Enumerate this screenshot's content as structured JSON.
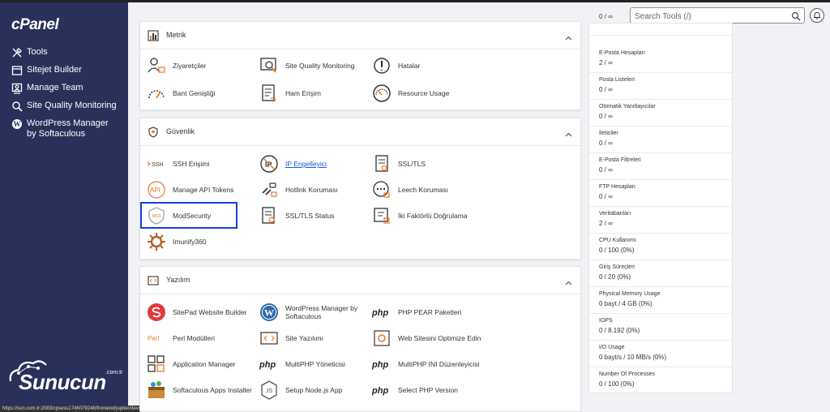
{
  "sidebar": {
    "logo": "cPanel",
    "items": [
      {
        "label": "Tools",
        "icon": "tools-icon"
      },
      {
        "label": "Sitejet Builder",
        "icon": "sitejet-icon"
      },
      {
        "label": "Manage Team",
        "icon": "team-icon"
      },
      {
        "label": "Site Quality Monitoring",
        "icon": "magnifier-icon"
      },
      {
        "label": "WordPress Manager by Softaculous",
        "icon": "wordpress-icon"
      }
    ],
    "brand": "Sunucun",
    "brand_suffix": ".com.tr"
  },
  "statusbar": "https://sun.com.tr:2083/cpsess1746079248/frontend/jupiter/devwin/index.html",
  "header": {
    "search_placeholder": "Search Tools (/)"
  },
  "sections": {
    "metrik": {
      "title": "Metrik",
      "items": [
        {
          "label": "Ziyaretçiler",
          "icon": "visitors-icon"
        },
        {
          "label": "Site Quality Monitoring",
          "icon": "site-quality-icon"
        },
        {
          "label": "Hatalar",
          "icon": "errors-icon"
        },
        {
          "label": "Bant Genişliği",
          "icon": "bandwidth-icon"
        },
        {
          "label": "Ham Erişim",
          "icon": "raw-access-icon"
        },
        {
          "label": "Resource Usage",
          "icon": "resource-usage-icon"
        }
      ]
    },
    "guvenlik": {
      "title": "Güvenlik",
      "items": [
        {
          "label": "SSH Erişimi",
          "icon": "ssh-icon"
        },
        {
          "label": "IP Engelleyici",
          "icon": "ip-blocker-icon"
        },
        {
          "label": "SSL/TLS",
          "icon": "ssl-icon"
        },
        {
          "label": "Manage API Tokens",
          "icon": "api-icon"
        },
        {
          "label": "Hotlink Koruması",
          "icon": "hotlink-icon"
        },
        {
          "label": "Leech Koruması",
          "icon": "leech-icon"
        },
        {
          "label": "ModSecurity",
          "icon": "modsecurity-icon"
        },
        {
          "label": "SSL/TLS Status",
          "icon": "ssl-status-icon"
        },
        {
          "label": "İki Faktörlü Doğrulama",
          "icon": "two-factor-icon"
        },
        {
          "label": "Imunify360",
          "icon": "imunify-icon"
        }
      ]
    },
    "yazilim": {
      "title": "Yazılım",
      "items": [
        {
          "label": "SitePad Website Builder",
          "icon": "sitepad-icon"
        },
        {
          "label": "WordPress Manager by Softaculous",
          "icon": "wordpress-icon"
        },
        {
          "label": "PHP PEAR Paketleri",
          "icon": "php-icon",
          "glyph": "php"
        },
        {
          "label": "Perl Modülleri",
          "icon": "perl-icon",
          "glyph": "Perl"
        },
        {
          "label": "Site Yazılımı",
          "icon": "site-software-icon"
        },
        {
          "label": "Web Sitesini Optimize Edin",
          "icon": "optimize-icon"
        },
        {
          "label": "Application Manager",
          "icon": "app-manager-icon"
        },
        {
          "label": "MultiPHP Yöneticisi",
          "icon": "php-icon",
          "glyph": "php"
        },
        {
          "label": "MultiPHP INI Düzenleyicisi",
          "icon": "php-icon",
          "glyph": "php"
        },
        {
          "label": "Softaculous Apps Installer",
          "icon": "softaculous-icon"
        },
        {
          "label": "Setup Node.js App",
          "icon": "nodejs-icon"
        },
        {
          "label": "Select PHP Version",
          "icon": "php-icon",
          "glyph": "php"
        }
      ]
    }
  },
  "stats": [
    {
      "label": "",
      "value": "0 / ∞"
    },
    {
      "label": "E-Posta Hesapları",
      "value": "2 / ∞"
    },
    {
      "label": "Posta Listeleri",
      "value": "0 / ∞"
    },
    {
      "label": "Otomatik Yanıtlayıcılar",
      "value": "0 / ∞"
    },
    {
      "label": "İleticiler",
      "value": "0 / ∞"
    },
    {
      "label": "E-Posta Filtreleri",
      "value": "0 / ∞"
    },
    {
      "label": "FTP Hesapları",
      "value": "0 / ∞"
    },
    {
      "label": "Veritabanları",
      "value": "2 / ∞"
    },
    {
      "label": "CPU Kullanımı",
      "value": "0 / 100   (0%)"
    },
    {
      "label": "Giriş Süreçleri",
      "value": "0 / 20   (0%)"
    },
    {
      "label": "Physical Memory Usage",
      "value": "0 bayt / 4 GB   (0%)"
    },
    {
      "label": "IOPS",
      "value": "0 / 8.192   (0%)"
    },
    {
      "label": "I/O Usage",
      "value": "0 bayt/s / 10 MB/s   (0%)"
    },
    {
      "label": "Number Of Processes",
      "value": "0 / 100   (0%)"
    }
  ]
}
